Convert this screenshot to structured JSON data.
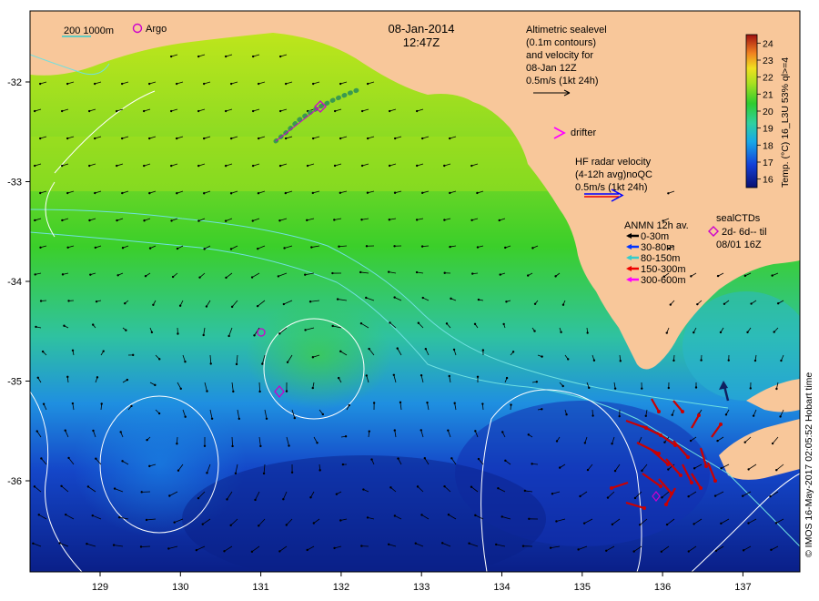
{
  "title": {
    "date": "08-Jan-2014",
    "time": "12:47Z"
  },
  "scale_legend": {
    "label": "200  1000m"
  },
  "argo_legend": {
    "label": "Argo"
  },
  "altimetry_note": {
    "lines": [
      "Altimetric sealevel",
      "(0.1m contours)",
      "and velocity for",
      "08-Jan 12Z",
      "0.5m/s (1kt 24h)"
    ]
  },
  "drifter_legend": {
    "label": "drifter"
  },
  "hf_radar_note": {
    "lines": [
      "HF radar velocity",
      "(4-12h avg)noQC",
      "0.5m/s (1kt 24h)"
    ]
  },
  "anmn_legend": {
    "title": "ANMN 12h av.",
    "items": [
      {
        "label": "0-30m",
        "color": "#000000"
      },
      {
        "label": "30-80m",
        "color": "#0033ff"
      },
      {
        "label": "80-150m",
        "color": "#33cccc"
      },
      {
        "label": "150-300m",
        "color": "#ee0000"
      },
      {
        "label": "300-600m",
        "color": "#ff00ff"
      }
    ]
  },
  "sealctd_legend": {
    "lines": [
      "sealCTDs",
      "2d- 6d-- til",
      "08/01 16Z"
    ]
  },
  "colorbar": {
    "label": "Temp. (°C) 16_L3U 53% ql>=4",
    "ticks": [
      "24",
      "23",
      "22",
      "21",
      "20",
      "19",
      "18",
      "17",
      "16"
    ],
    "min": 15.5,
    "max": 24.5
  },
  "credit": "© IMOS 16-May-2017 02:05:52 Hobart time",
  "axes": {
    "x_ticks": [
      "129",
      "130",
      "131",
      "132",
      "133",
      "134",
      "135",
      "136",
      "137"
    ],
    "y_ticks": [
      "-32",
      "-33",
      "-34",
      "-35",
      "-36"
    ]
  },
  "colors": {
    "land": "#f8c79a",
    "sea_warm": "#b8e51a",
    "sea_mid": "#3bcf2a",
    "sea_cool": "#20a8e0",
    "sea_cold": "#0a2a9a",
    "contour": "#ffffff",
    "isobath": "#6fe0e0",
    "argo": "#cc00cc",
    "drifter": "#ff00ff",
    "hf_radar": "#cc0000"
  }
}
